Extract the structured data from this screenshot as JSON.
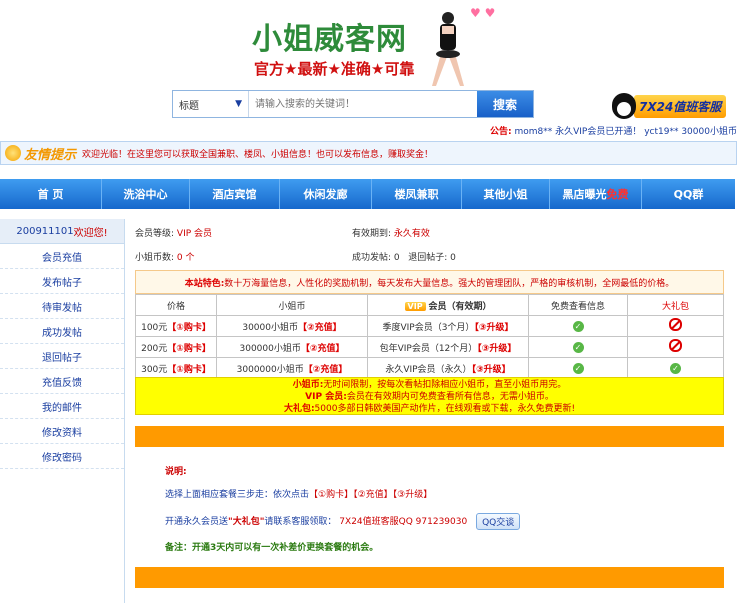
{
  "header": {
    "site_title": "小姐威客网",
    "slogan": "官方★最新★准确★可靠"
  },
  "search": {
    "select_value": "标题",
    "placeholder": "请输入搜索的关键词！",
    "button": "搜索"
  },
  "qq_service": {
    "label": "7X24值班客服"
  },
  "notice": {
    "label": "公告:",
    "text": "mom8** 永久VIP会员已开通！ yct19** 30000小姐币"
  },
  "tip": {
    "label": "友情提示",
    "text": "欢迎光临！在这里您可以获取全国兼职、楼凤、小姐信息！也可以发布信息，赚取奖金！"
  },
  "nav": [
    {
      "label": "首 页",
      "hot": ""
    },
    {
      "label": "洗浴中心",
      "hot": ""
    },
    {
      "label": "酒店宾馆",
      "hot": ""
    },
    {
      "label": "休闲发廊",
      "hot": ""
    },
    {
      "label": "楼凤兼职",
      "hot": ""
    },
    {
      "label": "其他小姐",
      "hot": ""
    },
    {
      "label": "黑店曝光",
      "hot": "免费"
    },
    {
      "label": "QQ群",
      "hot": ""
    }
  ],
  "sidebar": {
    "uid": "200911101",
    "welcome": "欢迎您!",
    "items": [
      "会员充值",
      "发布帖子",
      "待审发帖",
      "成功发帖",
      "退回帖子",
      "充值反馈",
      "我的邮件",
      "修改资料",
      "修改密码"
    ]
  },
  "account": {
    "level_label": "会员等级:",
    "level_value": "VIP 会员",
    "expire_label": "有效期到:",
    "expire_value": "永久有效",
    "coins_label": "小姐币数:",
    "coins_value": "0 个",
    "success_label": "成功发帖:",
    "success_value": "0",
    "returned_label": "退回帖子:",
    "returned_value": "0"
  },
  "feature": {
    "label": "本站特色:",
    "text": "数十万海量信息，人性化的奖励机制，每天发布大量信息。强大的管理团队，严格的审核机制，全网最低的价格。"
  },
  "price_table": {
    "headers": [
      "价格",
      "小姐币",
      "VIP",
      "会员（有效期）",
      "免费查看信息",
      "大礼包"
    ],
    "rows": [
      {
        "price": "100元",
        "buy": "【①购卡】",
        "coins": "30000小姐币",
        "charge": "【②充值】",
        "member": "季度VIP会员（3个月）",
        "upgrade": "【③升级】",
        "view": "ok",
        "gift": "no"
      },
      {
        "price": "200元",
        "buy": "【①购卡】",
        "coins": "300000小姐币",
        "charge": "【②充值】",
        "member": "包年VIP会员（12个月）",
        "upgrade": "【③升级】",
        "view": "ok",
        "gift": "no"
      },
      {
        "price": "300元",
        "buy": "【①购卡】",
        "coins": "3000000小姐币",
        "charge": "【②充值】",
        "member": "永久VIP会员（永久）",
        "upgrade": "【③升级】",
        "view": "ok",
        "gift": "ok"
      }
    ]
  },
  "legend": {
    "coins_k": "小姐币:",
    "coins_v": "无时间限制，按每次看帖扣除相应小姐币，直至小姐币用完。",
    "vip_k": "VIP 会员:",
    "vip_v": "会员在有效期内可免费查看所有信息，无需小姐币。",
    "gift_k": "大礼包:",
    "gift_v": "5000多部日韩欧美国产动作片，在线观看或下载，永久免费更新!"
  },
  "explain": {
    "title": "说明:",
    "step_prefix": "选择上面相应套餐三步走：依次点击",
    "step_buy": "【①购卡】",
    "step_charge": "【②充值】",
    "step_upgrade": "【③升级】",
    "gift_prefix": "开通永久会员送",
    "gift_name": "\"大礼包\"",
    "gift_mid": "请联系客服领取：",
    "gift_contact": "7X24值班客服QQ 971239030",
    "qq_talk": "QQ交谈",
    "note": "备注：开通3天内可以有一次补差价更换套餐的机会。"
  }
}
